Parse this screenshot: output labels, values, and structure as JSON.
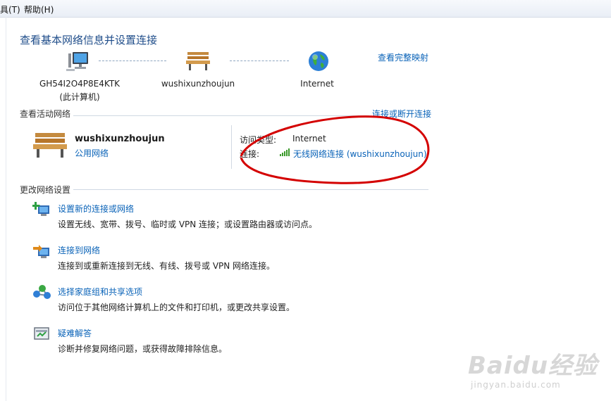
{
  "menu": {
    "tools": "具(T)",
    "help": "帮助(H)"
  },
  "header": {
    "title": "查看基本网络信息并设置连接",
    "full_map": "查看完整映射"
  },
  "map": {
    "computer_name": "GH54I2O4P8E4KTK",
    "computer_sub": "(此计算机)",
    "network_name": "wushixunzhoujun",
    "internet": "Internet"
  },
  "active": {
    "section": "查看活动网络",
    "connect_disconnect": "连接或断开连接",
    "name": "wushixunzhoujun",
    "type": "公用网络",
    "access_label": "访问类型:",
    "access_value": "Internet",
    "conn_label": "连接:",
    "conn_value": "无线网络连接 (wushixunzhoujun)"
  },
  "change": {
    "section": "更改网络设置",
    "tasks": [
      {
        "title": "设置新的连接或网络",
        "desc": "设置无线、宽带、拨号、临时或 VPN 连接；或设置路由器或访问点。"
      },
      {
        "title": "连接到网络",
        "desc": "连接到或重新连接到无线、有线、拨号或 VPN 网络连接。"
      },
      {
        "title": "选择家庭组和共享选项",
        "desc": "访问位于其他网络计算机上的文件和打印机，或更改共享设置。"
      },
      {
        "title": "疑难解答",
        "desc": "诊断并修复网络问题，或获得故障排除信息。"
      }
    ]
  },
  "watermark": {
    "brand": "Baidu经验",
    "url": "jingyan.baidu.com"
  },
  "colors": {
    "link": "#0a63b8",
    "annotation": "#d40000"
  }
}
